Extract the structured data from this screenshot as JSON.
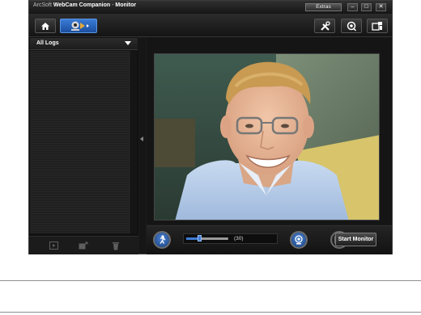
{
  "window": {
    "title_brand": "ArcSoft",
    "title_product": "WebCam Companion",
    "title_separator": "-",
    "title_section": "Monitor",
    "extras_label": "Extras",
    "minimize_glyph": "–",
    "maximize_glyph": "□",
    "close_glyph": "✕"
  },
  "toolbar": {
    "left_icons": [
      "home-icon",
      "webcam-monitor-icon"
    ],
    "right_icons": [
      "tools-icon",
      "webcam-settings-icon",
      "folder-options-icon"
    ]
  },
  "logs": {
    "dropdown_label": "All Logs",
    "bottom_icons": [
      "play-log-icon",
      "export-log-icon",
      "delete-log-icon"
    ]
  },
  "controls": {
    "sensitivity_value": "(30)",
    "sensitivity_fraction": 0.3,
    "start_label": "Start Monitor",
    "icons": [
      "motion-detect-icon",
      "webcam-icon",
      "fullscreen-icon"
    ]
  },
  "colors": {
    "accent": "#2f6cc4",
    "background": "#1a1a1a"
  }
}
